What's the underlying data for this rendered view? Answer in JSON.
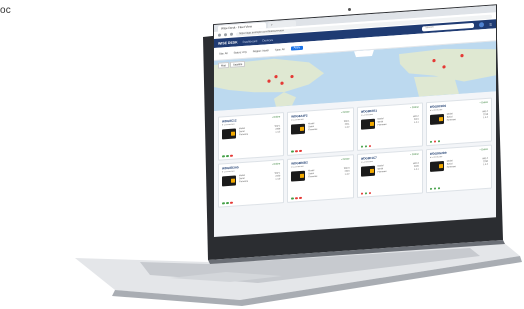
{
  "corner_text": "oc",
  "browser": {
    "active_tab": "Wise Desk - Fleet View",
    "inactive_tab": "+",
    "address": "https://app.example.com/fleet/overview"
  },
  "app": {
    "logo": "WISE DESK",
    "nav_items": [
      "Dashboard",
      "Devices"
    ],
    "search_placeholder": "Search",
    "menu_icon": "menu-icon"
  },
  "filters": {
    "chips": [
      "Site: All",
      "Status: Any",
      "Region: North",
      "Type: All"
    ],
    "apply_label": "Apply"
  },
  "map": {
    "toggle": [
      "Map",
      "Satellite"
    ],
    "markers": 7
  },
  "cards": [
    {
      "id": "WDG8C12",
      "status": "• Online",
      "sub": "● Connected",
      "fields": [
        [
          "Model",
          "WD-1"
        ],
        [
          "Serial",
          "2209"
        ],
        [
          "Firmware",
          "1.4.2"
        ]
      ],
      "icons": [
        "g",
        "g",
        "r"
      ]
    },
    {
      "id": "WDG8A4F2",
      "status": "• Online",
      "sub": "● Connected",
      "fields": [
        [
          "Model",
          "WD-1"
        ],
        [
          "Serial",
          "2211"
        ],
        [
          "Firmware",
          "1.4.2"
        ]
      ],
      "icons": [
        "g",
        "r",
        "r"
      ]
    },
    {
      "id": "WDG8B7E1",
      "status": "• Online",
      "sub": "● Connected",
      "fields": [
        [
          "Model",
          "WD-2"
        ],
        [
          "Serial",
          "2215"
        ],
        [
          "Firmware",
          "1.4.1"
        ]
      ],
      "icons": [
        "g",
        "g",
        "r"
      ]
    },
    {
      "id": "WDG8C9D0",
      "status": "• Online",
      "sub": "● Connected",
      "fields": [
        [
          "Model",
          "WD-2"
        ],
        [
          "Serial",
          "2218"
        ],
        [
          "Firmware",
          "1.4.2"
        ]
      ],
      "icons": [
        "g",
        "r",
        "g"
      ]
    },
    {
      "id": "WDG8D3A5",
      "status": "• Online",
      "sub": "● Connected",
      "fields": [
        [
          "Model",
          "WD-1"
        ],
        [
          "Serial",
          "2220"
        ],
        [
          "Firmware",
          "1.4.0"
        ]
      ],
      "icons": [
        "g",
        "g",
        "r"
      ]
    },
    {
      "id": "WDG8E6B2",
      "status": "• Online",
      "sub": "● Connected",
      "fields": [
        [
          "Model",
          "WD-3"
        ],
        [
          "Serial",
          "2223"
        ],
        [
          "Firmware",
          "1.4.2"
        ]
      ],
      "icons": [
        "g",
        "r",
        "r"
      ]
    },
    {
      "id": "WDG8F1C7",
      "status": "• Online",
      "sub": "● Connected",
      "fields": [
        [
          "Model",
          "WD-3"
        ],
        [
          "Serial",
          "2226"
        ],
        [
          "Firmware",
          "1.4.1"
        ]
      ],
      "icons": [
        "r",
        "g",
        "r"
      ]
    },
    {
      "id": "WDG8G2D9",
      "status": "• Online",
      "sub": "● Connected",
      "fields": [
        [
          "Model",
          "WD-2"
        ],
        [
          "Serial",
          "2230"
        ],
        [
          "Firmware",
          "1.4.2"
        ]
      ],
      "icons": [
        "g",
        "g",
        "g"
      ]
    }
  ]
}
